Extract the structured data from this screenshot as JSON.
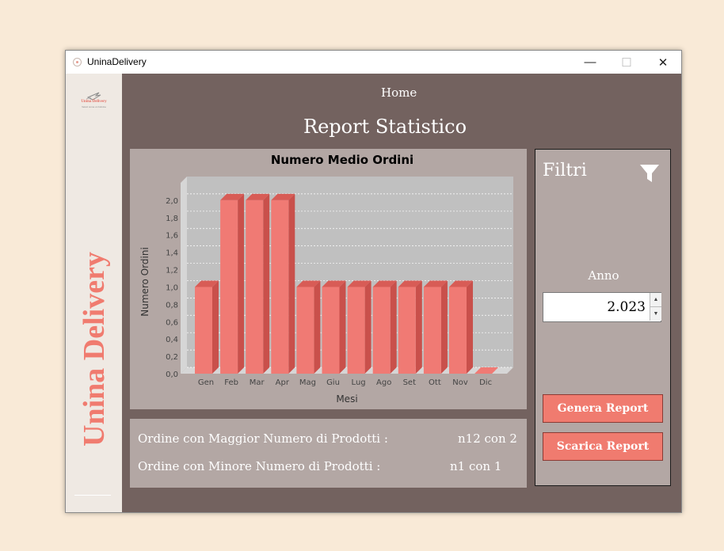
{
  "window": {
    "title": "UninaDelivery",
    "controls": {
      "minimize": "—",
      "maximize": "☐",
      "close": "✕"
    }
  },
  "sidebar": {
    "logo_text": "Unina Delivery",
    "logo_subtext": "Veloci come un fulmine",
    "brand_vertical": "Unina Delivery"
  },
  "header": {
    "home_link": "Home",
    "page_title": "Report Statistico"
  },
  "chart_data": {
    "type": "bar",
    "title": "Numero Medio Ordini",
    "xlabel": "Mesi",
    "ylabel": "Numero Ordini",
    "categories": [
      "Gen",
      "Feb",
      "Mar",
      "Apr",
      "Mag",
      "Giu",
      "Lug",
      "Ago",
      "Set",
      "Ott",
      "Nov",
      "Dic"
    ],
    "values": [
      1.0,
      2.0,
      2.0,
      2.0,
      1.0,
      1.0,
      1.0,
      1.0,
      1.0,
      1.0,
      1.0,
      0.0
    ],
    "ylim": [
      0,
      2.2
    ],
    "yticks": [
      "0,0",
      "0,2",
      "0,4",
      "0,6",
      "0,8",
      "1,0",
      "1,2",
      "1,4",
      "1,6",
      "1,8",
      "2,0"
    ],
    "yticks_values": [
      0,
      0.2,
      0.4,
      0.6,
      0.8,
      1.0,
      1.2,
      1.4,
      1.6,
      1.8,
      2.0
    ],
    "grid": true,
    "colors": {
      "bar": "#f07a74",
      "bar_side": "#c9504b",
      "plot_bg": "#c0c0c0",
      "grid": "#ffffff"
    }
  },
  "stats": {
    "max_label": "Ordine con Maggior Numero di Prodotti :",
    "max_value": "n12 con 2",
    "min_label": "Ordine con Minore Numero di Prodotti :",
    "min_value": "n1 con 1"
  },
  "filters": {
    "title": "Filtri",
    "icon": "filter-icon",
    "year_label": "Anno",
    "year_value": "2.023",
    "generate_button": "Genera Report",
    "download_button": "Scarica Report"
  },
  "colors": {
    "accent": "#f07b6f",
    "panel": "#b3a7a4",
    "content_bg": "#73625f",
    "sidebar_bg": "#efe9e3"
  }
}
